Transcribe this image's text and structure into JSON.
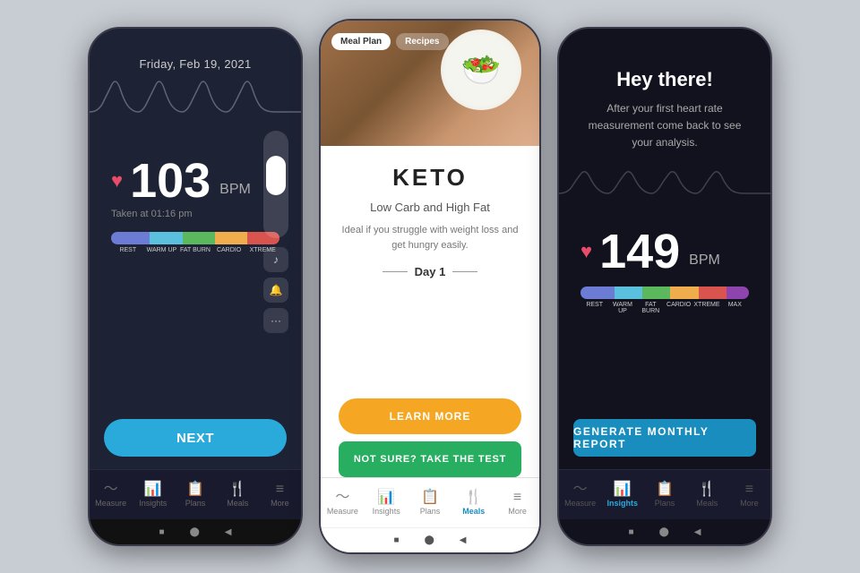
{
  "phone1": {
    "date": "Friday, Feb 19, 2021",
    "bpm": "103",
    "bpm_unit": "BPM",
    "taken_at": "Taken at 01:16 pm",
    "zones": [
      "REST",
      "WARM UP",
      "FAT BURN",
      "CARDIO",
      "XTREME"
    ],
    "next_label": "NEXT",
    "nav": [
      {
        "id": "measure",
        "label": "Measure",
        "active": false
      },
      {
        "id": "insights",
        "label": "Insights",
        "active": false
      },
      {
        "id": "plans",
        "label": "Plans",
        "active": false
      },
      {
        "id": "meals",
        "label": "Meals",
        "active": false
      },
      {
        "id": "more",
        "label": "More",
        "active": false
      }
    ]
  },
  "phone2": {
    "tabs": [
      {
        "label": "Meal Plan",
        "active": true
      },
      {
        "label": "Recipes",
        "active": false
      }
    ],
    "diet_name": "KETO",
    "subtitle": "Low Carb and High Fat",
    "description": "Ideal if you struggle with weight loss and get hungry easily.",
    "day_label": "Day 1",
    "learn_more": "LEARN MORE",
    "not_sure": "NOT SURE? TAKE THE TEST",
    "nav": [
      {
        "id": "measure",
        "label": "Measure",
        "active": false
      },
      {
        "id": "insights",
        "label": "Insights",
        "active": false
      },
      {
        "id": "plans",
        "label": "Plans",
        "active": false
      },
      {
        "id": "meals",
        "label": "Meals",
        "active": true
      },
      {
        "id": "more",
        "label": "More",
        "active": false
      }
    ]
  },
  "phone3": {
    "greeting": "Hey there!",
    "description": "After your first heart rate measurement come back to see your analysis.",
    "bpm": "149",
    "bpm_unit": "BPM",
    "zones": [
      "REST",
      "WARM UP",
      "FAT BURN",
      "CARDIO",
      "XTREME",
      "MAX"
    ],
    "generate_btn": "GENERATE MONTHLY REPORT",
    "nav": [
      {
        "id": "measure",
        "label": "Measure",
        "active": false
      },
      {
        "id": "insights",
        "label": "Insights",
        "active": true
      },
      {
        "id": "plans",
        "label": "Plans",
        "active": false
      },
      {
        "id": "meals",
        "label": "Meals",
        "active": false
      },
      {
        "id": "more",
        "label": "More",
        "active": false
      }
    ]
  },
  "icons": {
    "heart": "♥",
    "measure": "〜",
    "insights": "▮▮",
    "plans": "▦",
    "meals": "🍴",
    "more": "≡",
    "music": "♪",
    "bell": "🔔",
    "dots": "•••"
  }
}
